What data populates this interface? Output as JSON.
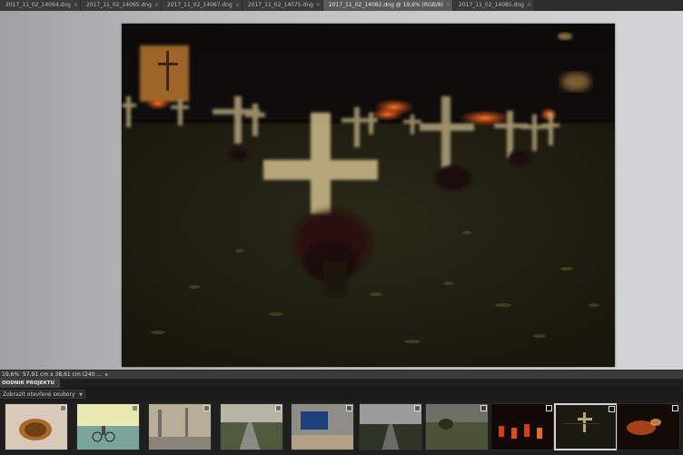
{
  "tabs": [
    {
      "label": "2017_11_02_14064.dng",
      "active": false
    },
    {
      "label": "2017_11_02_14065.dng",
      "active": false
    },
    {
      "label": "2017_11_02_14067.dng",
      "active": false
    },
    {
      "label": "2017_11_02_14075.dng",
      "active": false
    },
    {
      "label": "2017_11_02_14082.dng @ 19,6% (RGB/8)",
      "active": true
    },
    {
      "label": "2017_11_02_14085.dng",
      "active": false
    }
  ],
  "status": {
    "zoom": "19,6%",
    "doc_info": "57,91 cm x 38,61 cm (240 ..."
  },
  "project_bin": {
    "title": "OODNIK PROJEKTU",
    "show_dropdown": "Zobrazit otevřené soubory",
    "thumbnails": [
      {
        "name": "food-thumbnail",
        "selected": false
      },
      {
        "name": "cyclist-thumbnail",
        "selected": false
      },
      {
        "name": "street-thumbnail",
        "selected": false
      },
      {
        "name": "road-thumbnail",
        "selected": false
      },
      {
        "name": "desk-thumbnail",
        "selected": false
      },
      {
        "name": "road-dusk-thumbnail",
        "selected": false
      },
      {
        "name": "field-thumbnail",
        "selected": false
      },
      {
        "name": "candles-thumbnail",
        "selected": false
      },
      {
        "name": "cemetery-thumbnail",
        "selected": true
      },
      {
        "name": "lights-thumbnail",
        "selected": false
      }
    ]
  },
  "colors": {
    "workspace_bg": "#c4c7c8",
    "selected_border": "#cfd6dc"
  }
}
